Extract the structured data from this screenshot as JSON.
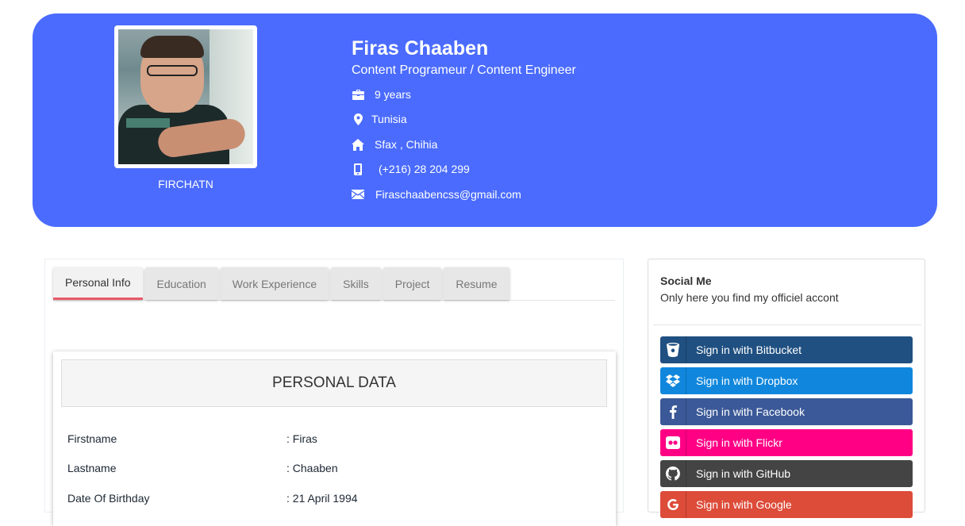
{
  "profile": {
    "username": "FIRCHATN",
    "name": "Firas Chaaben",
    "role": "Content Programeur / Content Engineer",
    "experience": "9 years",
    "country": "Tunisia",
    "address": "Sfax , Chihia",
    "phone": "(+216) 28 204 299",
    "email": "Firaschaabencss@gmail.com"
  },
  "tabs": [
    "Personal Info",
    "Education",
    "Work Experience",
    "Skills",
    "Project",
    "Resume"
  ],
  "active_tab": "Personal Info",
  "personal": {
    "heading": "PERSONAL DATA",
    "rows": [
      {
        "label": "Firstname",
        "value": ": Firas"
      },
      {
        "label": "Lastname",
        "value": ": Chaaben"
      },
      {
        "label": "Date Of Birthday",
        "value": ": 21 April 1994"
      }
    ]
  },
  "social": {
    "title": "Social Me",
    "subtitle": "Only here you find my officiel accont",
    "buttons": [
      {
        "label": "Sign in with Bitbucket",
        "icon": "bitbucket-icon",
        "color": "#205081"
      },
      {
        "label": "Sign in with Dropbox",
        "icon": "dropbox-icon",
        "color": "#1087dd"
      },
      {
        "label": "Sign in with Facebook",
        "icon": "facebook-icon",
        "color": "#3b5998"
      },
      {
        "label": "Sign in with Flickr",
        "icon": "flickr-icon",
        "color": "#ff0084"
      },
      {
        "label": "Sign in with GitHub",
        "icon": "github-icon",
        "color": "#444444"
      },
      {
        "label": "Sign in with Google",
        "icon": "google-icon",
        "color": "#dd4b39"
      }
    ]
  },
  "colors": {
    "hero": "#4a6bfd",
    "active_tab_underline": "#e85a68"
  }
}
